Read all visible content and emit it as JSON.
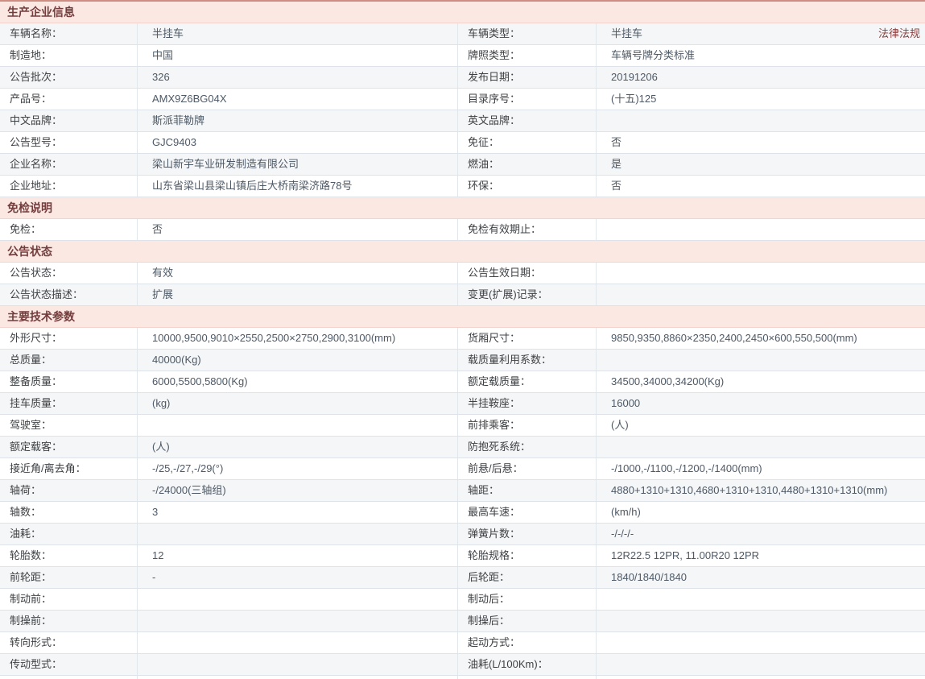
{
  "theme": {
    "section_header_bg": "#fce8e3",
    "section_header_text": "#733d3d",
    "row_stripe_bg": "#f5f6f7",
    "border_color": "#dde3e9",
    "link_text": "#8a4040",
    "top_rule": "#cf8d82"
  },
  "sections": [
    {
      "title": "生产企业信息",
      "rows": [
        {
          "l1": "车辆名称：",
          "v1": "半挂车",
          "l2": "车辆类型：",
          "v2": "半挂车",
          "link": "法律法规"
        },
        {
          "l1": "制造地：",
          "v1": "中国",
          "l2": "牌照类型：",
          "v2": "车辆号牌分类标准"
        },
        {
          "l1": "公告批次：",
          "v1": "326",
          "l2": "发布日期：",
          "v2": "20191206"
        },
        {
          "l1": "产品号：",
          "v1": "AMX9Z6BG04X",
          "l2": "目录序号：",
          "v2": "(十五)125"
        },
        {
          "l1": "中文品牌：",
          "v1": "斯派菲勒牌",
          "l2": "英文品牌：",
          "v2": ""
        },
        {
          "l1": "公告型号：",
          "v1": "GJC9403",
          "l2": "免征：",
          "v2": "否"
        },
        {
          "l1": "企业名称：",
          "v1": "梁山新宇车业研发制造有限公司",
          "l2": "燃油：",
          "v2": "是"
        },
        {
          "l1": "企业地址：",
          "v1": "山东省梁山县梁山镇后庄大桥南梁济路78号",
          "l2": "环保：",
          "v2": "否"
        }
      ]
    },
    {
      "title": "免检说明",
      "rows": [
        {
          "l1": "免检：",
          "v1": "否",
          "l2": "免检有效期止：",
          "v2": ""
        }
      ]
    },
    {
      "title": "公告状态",
      "rows": [
        {
          "l1": "公告状态：",
          "v1": "有效",
          "l2": "公告生效日期：",
          "v2": ""
        },
        {
          "l1": "公告状态描述：",
          "v1": "扩展",
          "l2": "变更(扩展)记录：",
          "v2": ""
        }
      ]
    },
    {
      "title": "主要技术参数",
      "rows": [
        {
          "l1": "外形尺寸：",
          "v1": "10000,9500,9010×2550,2500×2750,2900,3100(mm)",
          "l2": "货厢尺寸：",
          "v2": "9850,9350,8860×2350,2400,2450×600,550,500(mm)"
        },
        {
          "l1": "总质量：",
          "v1": "40000(Kg)",
          "l2": "载质量利用系数：",
          "v2": ""
        },
        {
          "l1": "整备质量：",
          "v1": "6000,5500,5800(Kg)",
          "l2": "额定载质量：",
          "v2": "34500,34000,34200(Kg)"
        },
        {
          "l1": "挂车质量：",
          "v1": "(kg)",
          "l2": "半挂鞍座：",
          "v2": "16000"
        },
        {
          "l1": "驾驶室：",
          "v1": "",
          "l2": "前排乘客：",
          "v2": "(人)"
        },
        {
          "l1": "额定载客：",
          "v1": "(人)",
          "l2": "防抱死系统：",
          "v2": ""
        },
        {
          "l1": "接近角/离去角：",
          "v1": "-/25,-/27,-/29(°)",
          "l2": "前悬/后悬：",
          "v2": "-/1000,-/1100,-/1200,-/1400(mm)"
        },
        {
          "l1": "轴荷：",
          "v1": "-/24000(三轴组)",
          "l2": "轴距：",
          "v2": "4880+1310+1310,4680+1310+1310,4480+1310+1310(mm)"
        },
        {
          "l1": "轴数：",
          "v1": "3",
          "l2": "最高车速：",
          "v2": "(km/h)"
        },
        {
          "l1": "油耗：",
          "v1": "",
          "l2": "弹簧片数：",
          "v2": "-/-/-/-"
        },
        {
          "l1": "轮胎数：",
          "v1": "12",
          "l2": "轮胎规格：",
          "v2": "12R22.5 12PR, 11.00R20 12PR"
        },
        {
          "l1": "前轮距：",
          "v1": "-",
          "l2": "后轮距：",
          "v2": "1840/1840/1840"
        },
        {
          "l1": "制动前：",
          "v1": "",
          "l2": "制动后：",
          "v2": ""
        },
        {
          "l1": "制操前：",
          "v1": "",
          "l2": "制操后：",
          "v2": ""
        },
        {
          "l1": "转向形式：",
          "v1": "",
          "l2": "起动方式：",
          "v2": ""
        },
        {
          "l1": "传动型式：",
          "v1": "",
          "l2": "油耗(L/100Km)：",
          "v2": ""
        }
      ]
    }
  ]
}
